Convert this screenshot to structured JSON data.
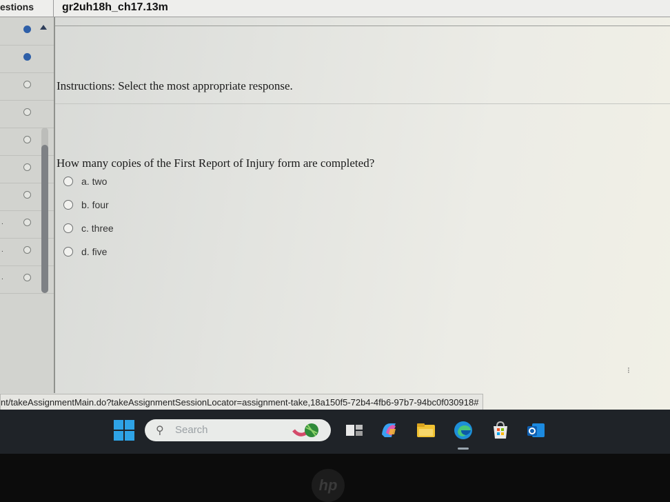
{
  "header": {
    "tab_label": "estions",
    "assignment_title": "gr2uh18h_ch17.13m"
  },
  "navigator": {
    "rows": [
      {
        "status": "answered",
        "mark": ""
      },
      {
        "status": "answered",
        "mark": ""
      },
      {
        "status": "unanswered",
        "mark": ""
      },
      {
        "status": "unanswered",
        "mark": ""
      },
      {
        "status": "unanswered",
        "mark": ""
      },
      {
        "status": "unanswered",
        "mark": ""
      },
      {
        "status": "unanswered",
        "mark": ""
      },
      {
        "status": "unanswered",
        "mark": "."
      },
      {
        "status": "unanswered",
        "mark": "."
      },
      {
        "status": "unanswered",
        "mark": "."
      }
    ]
  },
  "content": {
    "instructions": "Instructions: Select the most appropriate response.",
    "question": "How many copies of the First Report of Injury form are completed?",
    "options": [
      {
        "label": "a. two"
      },
      {
        "label": "b. four"
      },
      {
        "label": "c. three"
      },
      {
        "label": "d. five"
      }
    ]
  },
  "statusbar": {
    "url": "nt/takeAssignmentMain.do?takeAssignmentSessionLocator=assignment-take,18a150f5-72b4-4fb6-97b7-94bc0f030918#"
  },
  "taskbar": {
    "search_placeholder": "Search",
    "icons": [
      "windows-start-icon",
      "widgets-icon",
      "copilot-icon",
      "file-explorer-icon",
      "edge-browser-icon",
      "microsoft-store-icon",
      "outlook-icon"
    ]
  },
  "colors": {
    "answered_dot": "#2e5fa8",
    "taskbar_bg": "#1f2328",
    "screen_bg": "#e3e4e0"
  }
}
